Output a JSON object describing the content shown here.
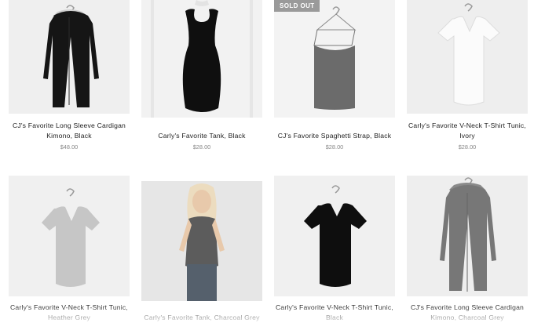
{
  "products": [
    {
      "title_lines": [
        "CJ's Favorite Long Sleeve Cardigan",
        "Kimono, Black"
      ],
      "price": "$48.00",
      "image": "black-cardigan-on-hanger"
    },
    {
      "title_lines": [
        "Carly's Favorite Tank, Black"
      ],
      "price": "$28.00",
      "image": "black-tank-on-mannequin"
    },
    {
      "title_lines": [
        "CJ's Favorite Spaghetti Strap, Black"
      ],
      "price": "$28.00",
      "image": "grey-cami-on-hanger",
      "badge": "SOLD OUT"
    },
    {
      "title_lines": [
        "Carly's Favorite V-Neck T-Shirt Tunic,",
        "Ivory"
      ],
      "price": "$28.00",
      "image": "ivory-tee-on-hanger"
    },
    {
      "title_lines": [
        "Carly's Favorite V-Neck T-Shirt Tunic,",
        "Heather Grey"
      ],
      "price": "",
      "image": "grey-tee-on-hanger"
    },
    {
      "title_lines": [
        "Carly's Favorite Tank, Charcoal Grey"
      ],
      "price": "",
      "image": "model-in-charcoal-tank"
    },
    {
      "title_lines": [
        "Carly's Favorite V-Neck T-Shirt Tunic,",
        "Black"
      ],
      "price": "",
      "image": "black-tee-on-hanger"
    },
    {
      "title_lines": [
        "CJ's Favorite Long Sleeve Cardigan",
        "Kimono, Charcoal Grey"
      ],
      "price": "",
      "image": "charcoal-cardigan-on-hanger"
    }
  ],
  "colors": {
    "badge_bg": "#9a9a9a",
    "price_text": "#888888",
    "image_bg": "#f1f1f1"
  }
}
